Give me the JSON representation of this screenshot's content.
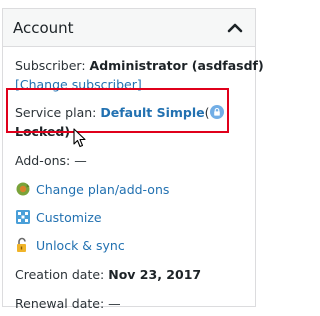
{
  "panel": {
    "title": "Account",
    "toggle_icon": "chevron-up-icon"
  },
  "subscriber": {
    "label": "Subscriber:",
    "value": "Administrator (asdfasdf)",
    "change_link": "[Change subscriber]"
  },
  "plan": {
    "label": "Service plan:",
    "name": "Default Simple",
    "paren_open": "(",
    "locked_label": "Locked)",
    "lock_icon": "lock-badge-icon",
    "highlight_color": "#e0001b"
  },
  "addons": {
    "label": "Add-ons:",
    "value": "—"
  },
  "actions": [
    {
      "label": "Change plan/add-ons",
      "icon": "change-plan-icon"
    },
    {
      "label": "Customize",
      "icon": "customize-icon"
    },
    {
      "label": "Unlock & sync",
      "icon": "unlock-icon"
    }
  ],
  "creation": {
    "label": "Creation date:",
    "value": "Nov 23, 2017"
  },
  "renewal": {
    "label": "Renewal date:",
    "value": "—"
  },
  "colors": {
    "link": "#2271b1",
    "text": "#2c3338",
    "lock_badge": "#72aee6"
  }
}
